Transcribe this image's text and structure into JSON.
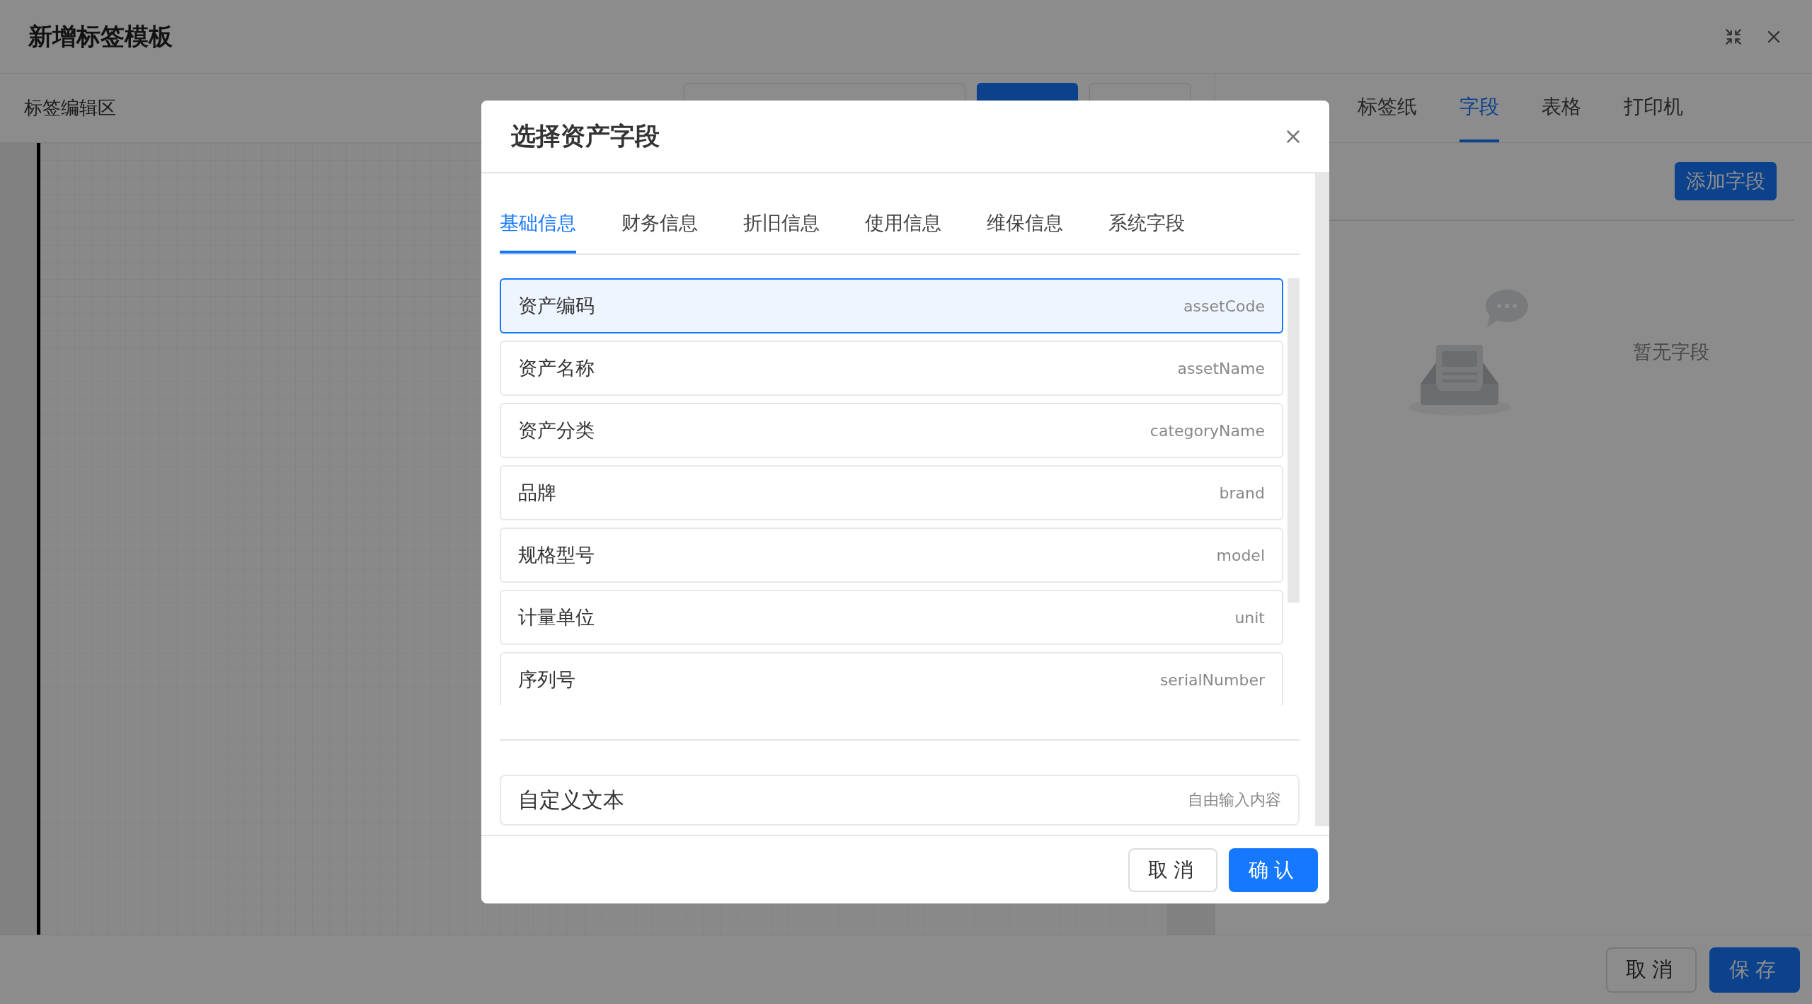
{
  "window": {
    "title": "新增标签模板"
  },
  "editor": {
    "title": "标签编辑区"
  },
  "panel": {
    "tabs": [
      {
        "label": "标签纸",
        "selected": false
      },
      {
        "label": "字段",
        "selected": true
      },
      {
        "label": "表格",
        "selected": false
      },
      {
        "label": "打印机",
        "selected": false
      }
    ],
    "add_button": "添加字段",
    "empty_text": "暂无字段"
  },
  "footer": {
    "buttons": [
      {
        "label": "取消",
        "kind": "default"
      },
      {
        "label": "保存",
        "kind": "primary"
      }
    ]
  },
  "dialog": {
    "title": "选择资产字段",
    "tabs": [
      {
        "label": "基础信息",
        "selected": true
      },
      {
        "label": "财务信息",
        "selected": false
      },
      {
        "label": "折旧信息",
        "selected": false
      },
      {
        "label": "使用信息",
        "selected": false
      },
      {
        "label": "维保信息",
        "selected": false
      },
      {
        "label": "系统字段",
        "selected": false
      }
    ],
    "fields": [
      {
        "label": "资产编码",
        "key": "assetCode",
        "selected": true
      },
      {
        "label": "资产名称",
        "key": "assetName",
        "selected": false
      },
      {
        "label": "资产分类",
        "key": "categoryName",
        "selected": false
      },
      {
        "label": "品牌",
        "key": "brand",
        "selected": false
      },
      {
        "label": "规格型号",
        "key": "model",
        "selected": false
      },
      {
        "label": "计量单位",
        "key": "unit",
        "selected": false
      },
      {
        "label": "序列号",
        "key": "serialNumber",
        "selected": false
      }
    ],
    "custom": {
      "label": "自定义文本",
      "hint": "自由输入内容"
    },
    "buttons": [
      {
        "label": "取消",
        "kind": "default"
      },
      {
        "label": "确认",
        "kind": "primary"
      }
    ]
  }
}
